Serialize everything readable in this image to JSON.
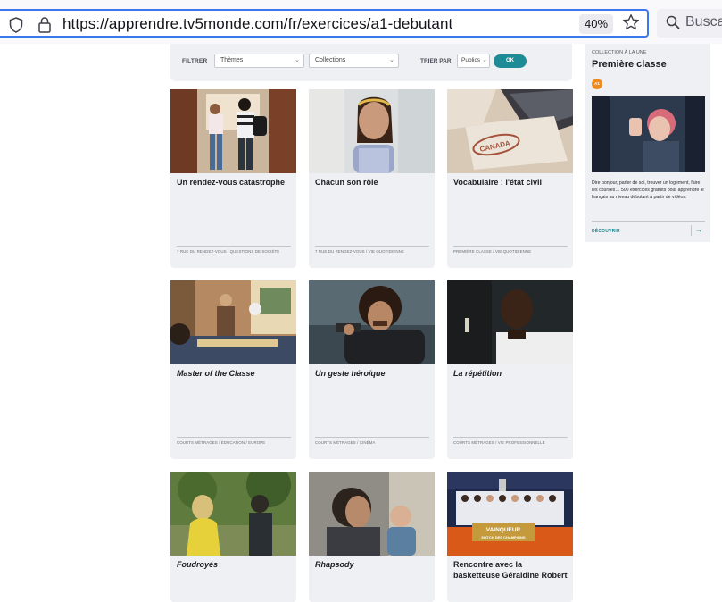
{
  "browser": {
    "url": "https://apprendre.tv5monde.com/fr/exercices/a1-debutant",
    "zoom": "40%",
    "search_placeholder": "Buscar"
  },
  "filters": {
    "filter_label": "FILTRER",
    "theme_value": "Thèmes",
    "collection_value": "Collections",
    "sort_label": "TRIER PAR",
    "sort_value": "Publics",
    "ok_label": "OK"
  },
  "cards": [
    {
      "title": "Un rendez-vous catastrophe",
      "tags": "7 RUE DU RENDEZ-VOUS  /  QUESTIONS DE SOCIÉTÉ"
    },
    {
      "title": "Chacun son rôle",
      "tags": "7 RUE DU RENDEZ-VOUS  /  VIE QUOTIDIENNE"
    },
    {
      "title": "Vocabulaire : l'état civil",
      "tags": "PREMIÈRE CLASSE  /  VIE QUOTIDIENNE"
    },
    {
      "title": "Master of the Classe",
      "tags": "COURTS MÉTRAGES  /  ÉDUCATION  /  EUROPE"
    },
    {
      "title": "Un geste héroïque",
      "tags": "COURTS MÉTRAGES  /  CINÉMA"
    },
    {
      "title": "La répétition",
      "tags": "COURTS MÉTRAGES  /  VIE PROFESSIONNELLE"
    },
    {
      "title": "Foudroyés",
      "tags": ""
    },
    {
      "title": "Rhapsody",
      "tags": ""
    },
    {
      "title": "Rencontre avec la basketteuse Géraldine Robert",
      "tags": "",
      "banner_line1": "VAINQUEUR",
      "banner_line2": "MATCH DES CHAMPIONS"
    }
  ],
  "promo": {
    "kicker": "COLLECTION À LA UNE",
    "title": "Première classe",
    "level": "A1",
    "description": "Dire bonjour, parler de soi, trouver un logement, faire les courses… 500 exercices gratuits pour apprendre le français au niveau débutant à partir de vidéos.",
    "discover_label": "DÉCOUVRIR",
    "arrow": "→"
  },
  "colors": {
    "accent": "#1e8c97",
    "level_badge": "#f18a1d",
    "card_bg": "#eef0f3",
    "url_focus": "#3b78f0"
  },
  "icons": {
    "shield": "shield-icon",
    "lock": "lock-icon",
    "star": "star-icon",
    "search": "search-icon"
  }
}
